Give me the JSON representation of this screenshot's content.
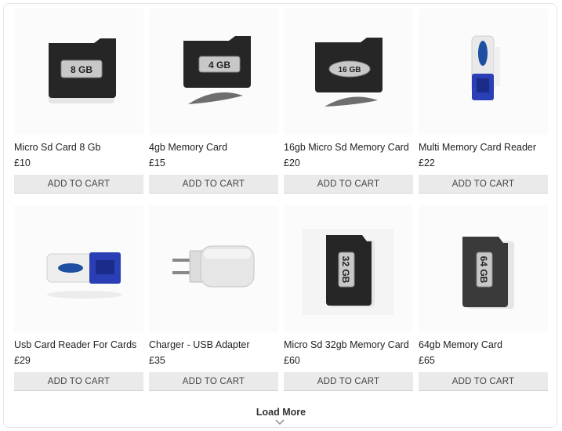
{
  "products": [
    {
      "name": "Micro Sd Card 8 Gb",
      "price": "£10",
      "button": "ADD TO CART",
      "image_label": "8 GB"
    },
    {
      "name": "4gb Memory Card",
      "price": "£15",
      "button": "ADD TO CART",
      "image_label": "4 GB"
    },
    {
      "name": "16gb Micro Sd Memory Card",
      "price": "£20",
      "button": "ADD TO CART",
      "image_label": "16 GB"
    },
    {
      "name": "Multi Memory Card Reader",
      "price": "£22",
      "button": "ADD TO CART",
      "image_label": ""
    },
    {
      "name": "Usb Card Reader For Cards",
      "price": "£29",
      "button": "ADD TO CART",
      "image_label": ""
    },
    {
      "name": "Charger - USB Adapter",
      "price": "£35",
      "button": "ADD TO CART",
      "image_label": ""
    },
    {
      "name": "Micro Sd 32gb Memory Card",
      "price": "£60",
      "button": "ADD TO CART",
      "image_label": "32 GB"
    },
    {
      "name": "64gb Memory Card",
      "price": "£65",
      "button": "ADD TO CART",
      "image_label": "64 GB"
    }
  ],
  "load_more": {
    "label": "Load More",
    "icon": "chevron-down-icon"
  }
}
